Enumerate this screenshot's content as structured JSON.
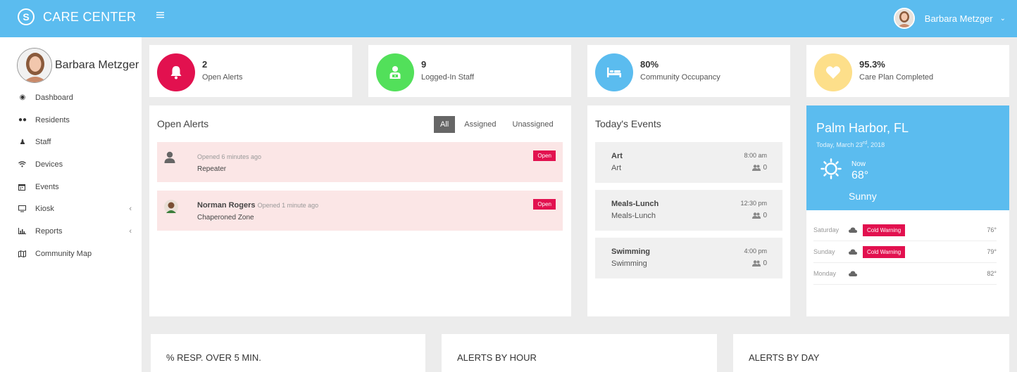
{
  "app": {
    "logo_letter": "S",
    "name": "CARE CENTER",
    "menu_icon": "hamburger-icon"
  },
  "user": {
    "name": "Barbara Metzger"
  },
  "sidebar": {
    "profile_name": "Barbara Metzger",
    "items": [
      {
        "label": "Dashboard",
        "icon": "dashboard-icon",
        "has_arrow": false
      },
      {
        "label": "Residents",
        "icon": "users-icon",
        "has_arrow": false
      },
      {
        "label": "Staff",
        "icon": "staff-icon",
        "has_arrow": false
      },
      {
        "label": "Devices",
        "icon": "wifi-icon",
        "has_arrow": false
      },
      {
        "label": "Events",
        "icon": "calendar-icon",
        "has_arrow": false
      },
      {
        "label": "Kiosk",
        "icon": "monitor-icon",
        "has_arrow": true
      },
      {
        "label": "Reports",
        "icon": "bar-chart-icon",
        "has_arrow": true
      },
      {
        "label": "Community Map",
        "icon": "map-icon",
        "has_arrow": false
      }
    ]
  },
  "stats": [
    {
      "value": "2",
      "label": "Open Alerts",
      "color": "#e2114f",
      "icon": "bell-icon"
    },
    {
      "value": "9",
      "label": "Logged-In Staff",
      "color": "#52e05a",
      "icon": "staff-badge-icon"
    },
    {
      "value": "80%",
      "label": "Community Occupancy",
      "color": "#5bbcef",
      "icon": "bed-icon"
    },
    {
      "value": "95.3%",
      "label": "Care Plan Completed",
      "color": "#fddf8a",
      "icon": "heart-icon"
    }
  ],
  "alerts": {
    "title": "Open Alerts",
    "filters": [
      "All",
      "Assigned",
      "Unassigned"
    ],
    "active_filter": "All",
    "items": [
      {
        "name": "",
        "meta": "Opened 6 minutes ago",
        "location": "Repeater",
        "status": "Open"
      },
      {
        "name": "Norman Rogers",
        "meta": "Opened 1 minute ago",
        "location": "Chaperoned Zone",
        "status": "Open"
      }
    ]
  },
  "events": {
    "title": "Today's Events",
    "items": [
      {
        "name": "Art",
        "sub": "Art",
        "time": "8:00 am",
        "count": "0"
      },
      {
        "name": "Meals-Lunch",
        "sub": "Meals-Lunch",
        "time": "12:30 pm",
        "count": "0"
      },
      {
        "name": "Swimming",
        "sub": "Swimming",
        "time": "4:00 pm",
        "count": "0"
      }
    ]
  },
  "weather": {
    "city": "Palm Harbor, FL",
    "date_prefix": "Today, March 23",
    "date_sup": "rd",
    "date_suffix": ", 2018",
    "now_label": "Now",
    "temp": "68°",
    "condition": "Sunny",
    "forecast": [
      {
        "day": "Saturday",
        "warning": "Cold Warning",
        "temp": "76°"
      },
      {
        "day": "Sunday",
        "warning": "Cold Warning",
        "temp": "79°"
      },
      {
        "day": "Monday",
        "warning": "",
        "temp": "82°"
      }
    ]
  },
  "bottom_panels": [
    "% RESP. OVER 5 MIN.",
    "ALERTS BY HOUR",
    "ALERTS BY DAY"
  ]
}
